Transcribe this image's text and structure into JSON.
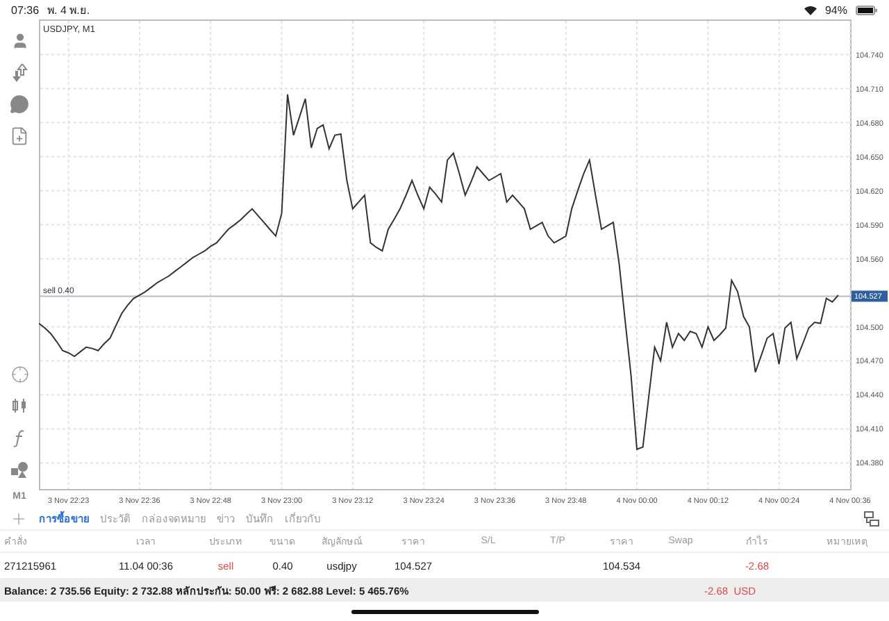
{
  "status_bar": {
    "time": "07:36",
    "date": "พ. 4 พ.ย.",
    "battery": "94%"
  },
  "toolbar": {
    "timeframe": "M1"
  },
  "chart": {
    "order_line": {
      "price_tag": "104.527"
    },
    "chart_data": {
      "type": "line",
      "title": "USDJPY, M1",
      "grid": true,
      "ref_lines": [
        {
          "axis": "y",
          "value": 104.527,
          "label": "sell 0.40"
        }
      ],
      "categories": [
        null,
        null,
        null,
        null,
        null,
        "3 Nov 22:23",
        null,
        null,
        null,
        null,
        null,
        null,
        null,
        null,
        null,
        null,
        null,
        "3 Nov 22:36",
        null,
        null,
        null,
        null,
        null,
        null,
        null,
        null,
        null,
        null,
        null,
        "3 Nov 22:48",
        null,
        null,
        null,
        null,
        null,
        null,
        null,
        null,
        null,
        null,
        null,
        "3 Nov 23:00",
        null,
        null,
        null,
        null,
        null,
        null,
        null,
        null,
        null,
        null,
        null,
        "3 Nov 23:12",
        null,
        null,
        null,
        null,
        null,
        null,
        null,
        null,
        null,
        null,
        null,
        "3 Nov 23:24",
        null,
        null,
        null,
        null,
        null,
        null,
        null,
        null,
        null,
        null,
        null,
        "3 Nov 23:36",
        null,
        null,
        null,
        null,
        null,
        null,
        null,
        null,
        null,
        null,
        null,
        "3 Nov 23:48",
        null,
        null,
        null,
        null,
        null,
        null,
        null,
        null,
        null,
        null,
        null,
        "4 Nov 00:00",
        null,
        null,
        null,
        null,
        null,
        null,
        null,
        null,
        null,
        null,
        null,
        "4 Nov 00:12",
        null,
        null,
        null,
        null,
        null,
        null,
        null,
        null,
        null,
        null,
        null,
        "4 Nov 00:24",
        null,
        null,
        null,
        null,
        null,
        null,
        null,
        null,
        null,
        null,
        null,
        "4 Nov 00:36"
      ],
      "series": [
        {
          "color": "#333333",
          "values": [
            104.503,
            104.499,
            104.494,
            104.487,
            104.479,
            104.477,
            104.474,
            104.478,
            104.482,
            104.481,
            104.479,
            104.485,
            104.49,
            104.501,
            104.512,
            104.519,
            104.525,
            104.528,
            104.531,
            104.535,
            104.539,
            104.542,
            104.545,
            104.549,
            104.553,
            104.557,
            104.561,
            104.564,
            104.567,
            104.571,
            104.574,
            104.58,
            104.586,
            104.59,
            104.594,
            104.599,
            104.604,
            104.598,
            104.592,
            104.586,
            104.58,
            104.6,
            104.705,
            104.669,
            104.685,
            104.701,
            104.658,
            104.675,
            104.678,
            104.657,
            104.669,
            104.67,
            104.629,
            104.604,
            104.61,
            104.616,
            104.574,
            104.57,
            104.567,
            104.586,
            104.595,
            104.604,
            104.616,
            104.629,
            104.616,
            104.604,
            104.623,
            104.617,
            104.61,
            104.647,
            104.653,
            104.635,
            104.616,
            104.628,
            104.641,
            104.635,
            104.629,
            104.632,
            104.635,
            104.61,
            104.616,
            104.61,
            104.604,
            104.586,
            104.589,
            104.592,
            104.58,
            104.574,
            104.577,
            104.58,
            104.604,
            104.62,
            104.635,
            104.647,
            104.616,
            104.586,
            104.589,
            104.592,
            104.555,
            104.506,
            104.457,
            104.392,
            104.394,
            104.439,
            104.482,
            104.47,
            104.504,
            104.482,
            104.494,
            104.488,
            104.496,
            104.494,
            104.482,
            104.5,
            104.488,
            104.493,
            104.499,
            104.541,
            104.531,
            104.509,
            104.5,
            104.46,
            104.475,
            104.49,
            104.494,
            104.467,
            104.499,
            104.504,
            104.472,
            104.485,
            104.499,
            104.504,
            104.503,
            104.525,
            104.522,
            104.528,
            null,
            null
          ]
        }
      ],
      "ylim": [
        104.357,
        104.771
      ],
      "yticks": [
        {
          "value": 104.38,
          "label": "104.380"
        },
        {
          "value": 104.41,
          "label": "104.410"
        },
        {
          "value": 104.44,
          "label": "104.440"
        },
        {
          "value": 104.47,
          "label": "104.470"
        },
        {
          "value": 104.5,
          "label": "104.500"
        },
        {
          "value": 104.56,
          "label": "104.560"
        },
        {
          "value": 104.59,
          "label": "104.590"
        },
        {
          "value": 104.62,
          "label": "104.620"
        },
        {
          "value": 104.65,
          "label": "104.650"
        },
        {
          "value": 104.68,
          "label": "104.680"
        },
        {
          "value": 104.71,
          "label": "104.710"
        },
        {
          "value": 104.74,
          "label": "104.740"
        }
      ]
    }
  },
  "tabs": [
    {
      "label": "การซื้อขาย",
      "selected": true
    },
    {
      "label": "ประวัติ",
      "selected": false
    },
    {
      "label": "กล่องจดหมาย",
      "selected": false
    },
    {
      "label": "ข่าว",
      "selected": false
    },
    {
      "label": "บันทึก",
      "selected": false
    },
    {
      "label": "เกี่ยวกับ",
      "selected": false
    }
  ],
  "table": {
    "columns": [
      "คำสั่ง",
      "เวลา",
      "ประเภท",
      "ขนาด",
      "สัญลักษณ์",
      "ราคา",
      "S/L",
      "T/P",
      "ราคา",
      "Swap",
      "กำไร",
      "หมายเหตุ"
    ],
    "rows": [
      {
        "order": "271215961",
        "time": "11.04 00:36",
        "type": {
          "label": "sell",
          "kind": "sell"
        },
        "volume": "0.40",
        "symbol": "usdjpy",
        "price": "104.527",
        "current_price": "104.534",
        "profit": "-2.68",
        "profit_negative": true
      }
    ]
  },
  "summary": {
    "text": "Balance: 2 735.56 Equity: 2 732.88 หลักประกัน: 50.00 ฟรี: 2 682.88 Level: 5 465.76%",
    "total": "-2.68  USD",
    "total_negative": true
  }
}
